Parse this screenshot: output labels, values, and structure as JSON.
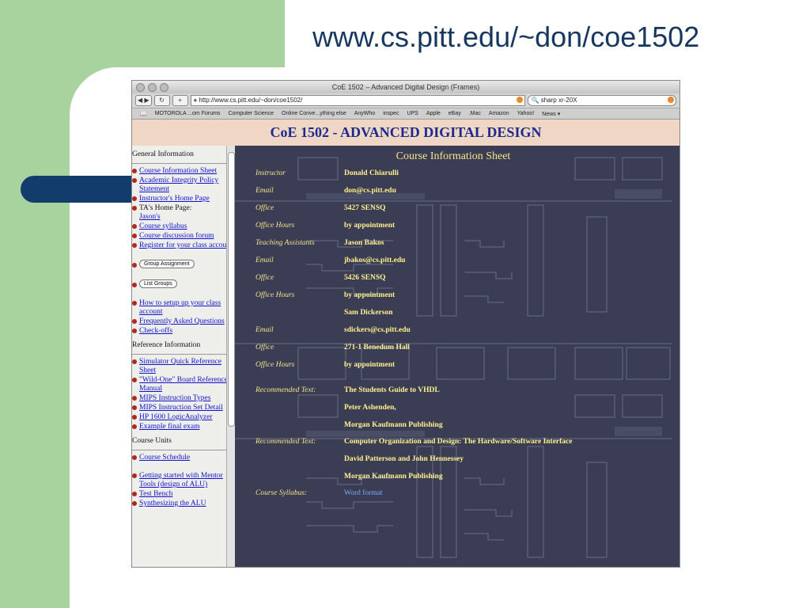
{
  "slide": {
    "title": "www.cs.pitt.edu/~don/coe1502"
  },
  "browser": {
    "window_title": "CoE 1502 – Advanced Digital Design (Frames)",
    "url": "http://www.cs.pitt.edu/~don/coe1502/",
    "search": "sharp xr-20X",
    "bookmarks": [
      "MOTOROLA ...om Forums",
      "Computer Science",
      "Online Conve...ything else",
      "AnyWho",
      "inspec",
      "UPS",
      "Apple",
      "eBay",
      ".Mac",
      "Amazon",
      "Yahoo!",
      "News ▾"
    ]
  },
  "banner": {
    "title": "CoE 1502 - ADVANCED DIGITAL DESIGN"
  },
  "sidebar": {
    "general": "General Information",
    "links1": [
      "Course Information Sheet",
      "Academic Integrity Policy Statement",
      "Instructor's Home Page"
    ],
    "ta_label": "TA's Home Page:",
    "ta_link": "Jason's",
    "links2": [
      "Course syllabus",
      "Course discussion forum",
      "Register for your class account"
    ],
    "btn_group": "Group Assignment",
    "btn_list": "List Groups",
    "links3": [
      "How to setup up your class account",
      "Frequently Asked Questions",
      "Check-offs"
    ],
    "reference": "Reference Information",
    "links4": [
      "Simulator Quick Reference Sheet",
      "\"Wild-One\" Board Reference Manual",
      "MIPS Instruction Types",
      "MIPS Instruction Set Detail",
      "HP 1600 LogicAnalyzer",
      "Example final exam"
    ],
    "units": "Course Units",
    "links5": [
      "Course Schedule"
    ],
    "links6": [
      "Getting started with Mentor Tools (design of ALU)",
      "Test Bench",
      "Synthesizing the ALU"
    ]
  },
  "sheet": {
    "title": "Course Information Sheet",
    "rows": [
      {
        "label": "Instructor",
        "value": "Donald Chiarulli"
      },
      {
        "label": "Email",
        "value": "don@cs.pitt.edu"
      },
      {
        "label": "Office",
        "value": "5427 SENSQ"
      },
      {
        "label": "Office Hours",
        "value": "by appointment"
      },
      {
        "label": "Teaching Assistants",
        "value": "Jason Bakos"
      },
      {
        "label": "Email",
        "value": "jbakos@cs.pitt.edu"
      },
      {
        "label": "Office",
        "value": "5426 SENSQ"
      },
      {
        "label": "Office Hours",
        "value": "by appointment"
      },
      {
        "label": "",
        "value": "Sam Dickerson"
      },
      {
        "label": "Email",
        "value": "sdickers@cs.pitt.edu"
      },
      {
        "label": "Office",
        "value": "271-1 Benedum Hall"
      },
      {
        "label": "Office Hours",
        "value": "by appointment"
      },
      {
        "label": "Recommended Text:",
        "value": "The Students Guide to VHDL"
      },
      {
        "label": "",
        "value": "Peter Ashenden,"
      },
      {
        "label": "",
        "value": "Morgan Kaufmann Publishing"
      },
      {
        "label": "Recommended Text:",
        "value": "Computer Organization and Design: The Hardware/Software Interface"
      },
      {
        "label": "",
        "value": "David Patterson and John Hennessey"
      },
      {
        "label": "",
        "value": "Morgan Kaufmann Publishing"
      },
      {
        "label": "Course Syllabus:",
        "value": "Word format"
      }
    ]
  }
}
